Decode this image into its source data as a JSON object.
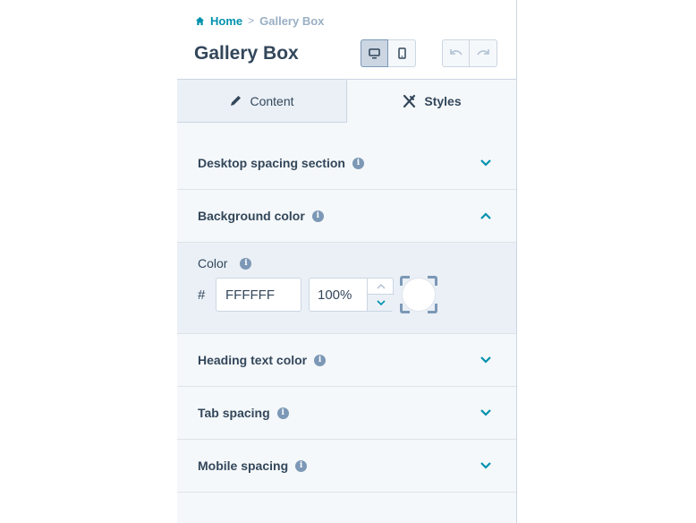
{
  "breadcrumb": {
    "home": "Home",
    "separator": ">",
    "current": "Gallery Box"
  },
  "header": {
    "title": "Gallery Box"
  },
  "view_toggle": {
    "active": "desktop",
    "icons": [
      "desktop-icon",
      "mobile-icon"
    ]
  },
  "history": {
    "icons": [
      "undo-icon",
      "redo-icon"
    ]
  },
  "tabs": [
    {
      "label": "Content",
      "icon": "pencil-icon",
      "active": false
    },
    {
      "label": "Styles",
      "icon": "styles-icon",
      "active": true
    }
  ],
  "sections": [
    {
      "label": "Desktop spacing section",
      "expanded": false
    },
    {
      "label": "Background color",
      "expanded": true
    },
    {
      "label": "Heading text color",
      "expanded": false
    },
    {
      "label": "Tab spacing",
      "expanded": false
    },
    {
      "label": "Mobile spacing",
      "expanded": false
    }
  ],
  "background_color": {
    "color_label": "Color",
    "hash": "#",
    "hex_value": "FFFFFF",
    "opacity_value": "100%",
    "swatch_color": "#ffffff"
  },
  "colors": {
    "accent": "#0091ae",
    "text": "#33475b",
    "panel_bg": "#f5f8fa",
    "border": "#cbd6e2"
  }
}
